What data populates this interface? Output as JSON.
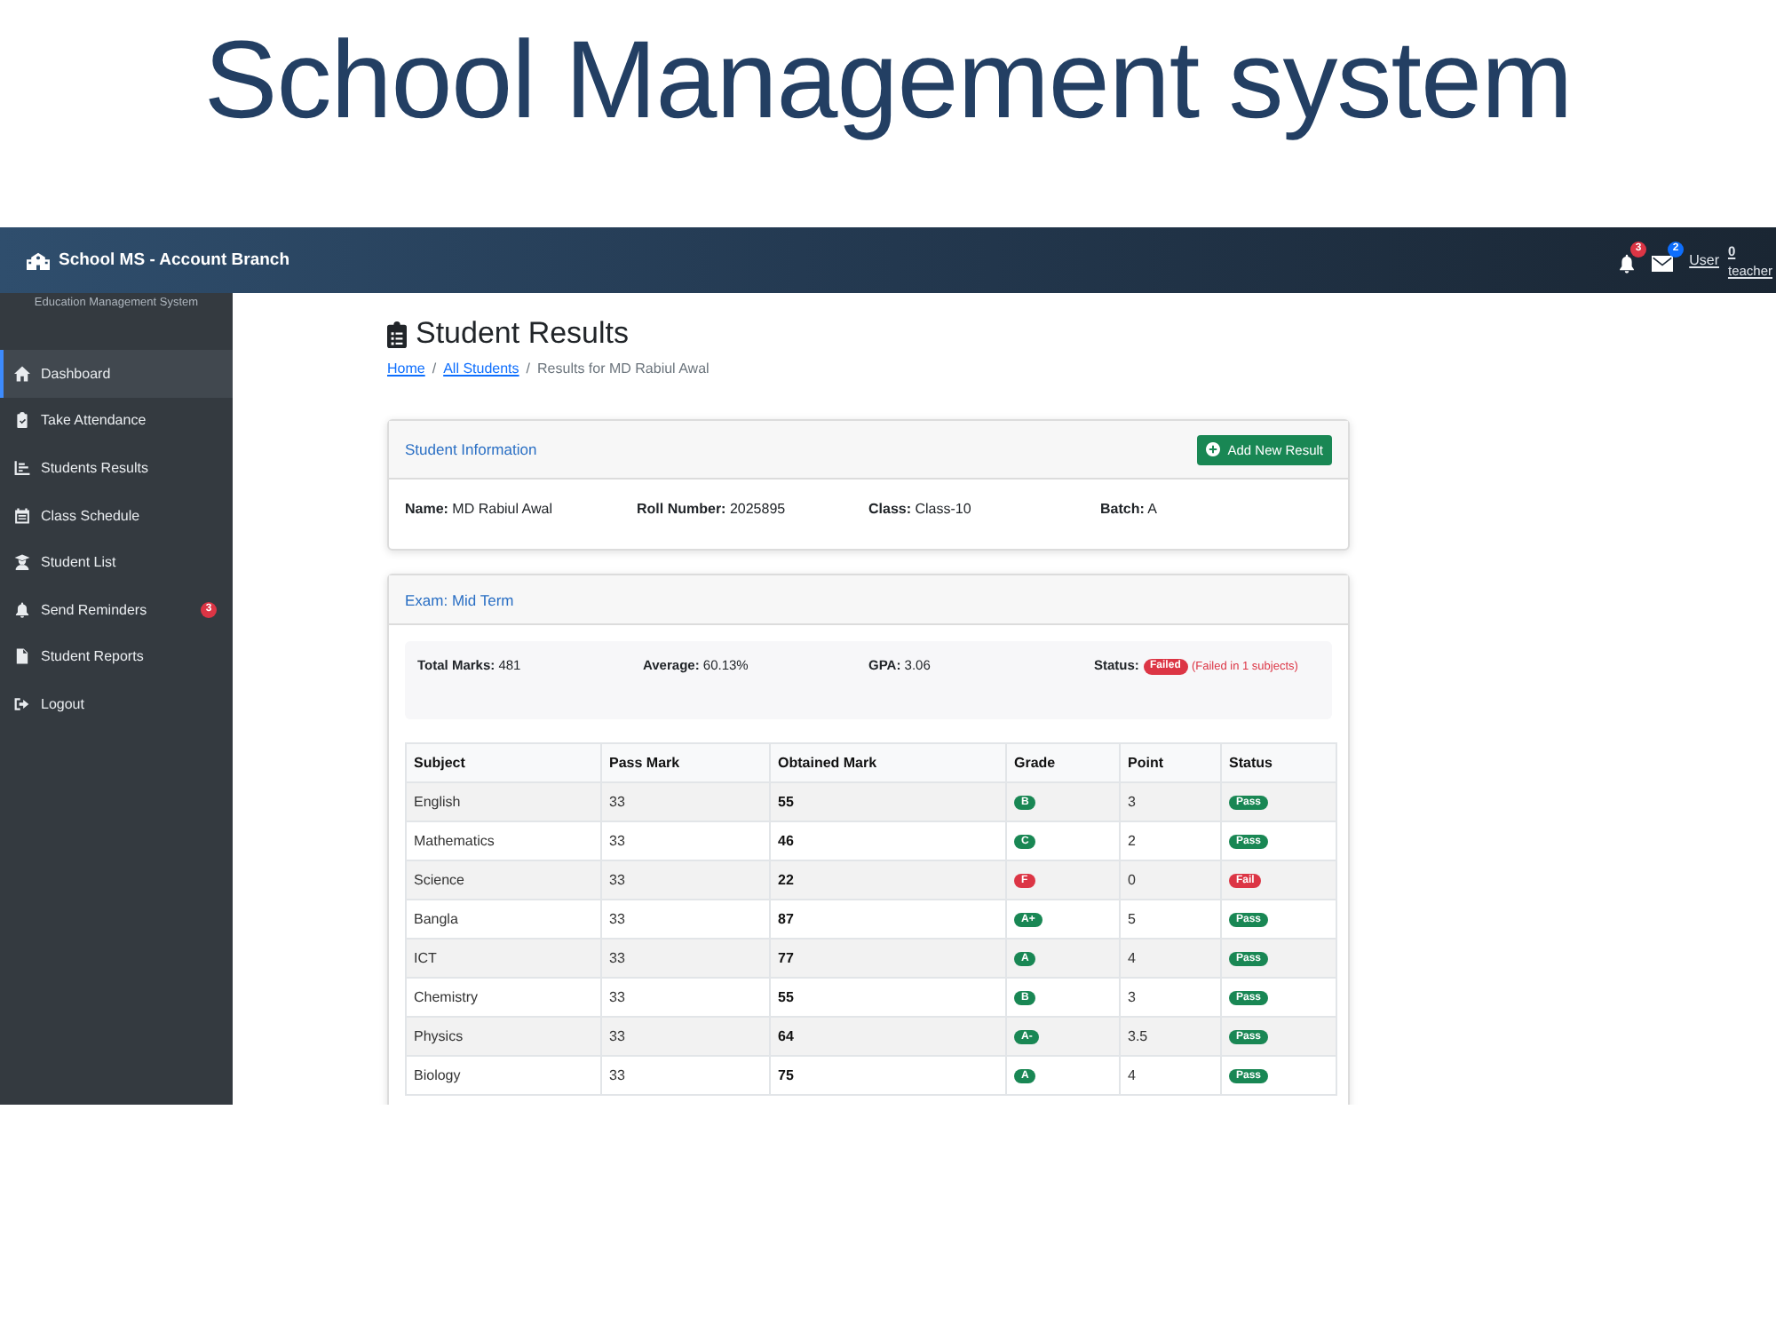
{
  "page_heading": "School Management system",
  "navbar": {
    "brand": "School MS - Account Branch",
    "notification_count": "3",
    "message_count": "2",
    "user_link": "User",
    "role_link": "**0** teacher"
  },
  "sidebar": {
    "subtitle": "Education Management System",
    "items": [
      {
        "label": "Dashboard",
        "selected": true
      },
      {
        "label": "Take Attendance",
        "selected": false
      },
      {
        "label": "Students Results",
        "selected": false
      },
      {
        "label": "Class Schedule",
        "selected": false
      },
      {
        "label": "Student List",
        "selected": false
      },
      {
        "label": "Send Reminders",
        "selected": false,
        "badge": "3"
      },
      {
        "label": "Student Reports",
        "selected": false
      },
      {
        "label": "Logout",
        "selected": false
      }
    ]
  },
  "page": {
    "title": "Student Results",
    "breadcrumb": [
      {
        "kind": "link",
        "label": "Home"
      },
      {
        "kind": "separator",
        "label": "/"
      },
      {
        "kind": "link",
        "label": "All Students"
      },
      {
        "kind": "separator",
        "label": "/"
      },
      {
        "kind": "current",
        "label": "Results for MD Rabiul Awal"
      }
    ]
  },
  "student_card": {
    "title": "Student Information",
    "button": "Add New Result",
    "fields": [
      "**Name:** MD Rabiul Awal",
      "**Roll Number:** 2025895",
      "**Class:** Class-10",
      "**Batch:** A"
    ]
  },
  "exam_card": {
    "title": "Exam: Mid Term",
    "summary": [
      "**Total Marks:** 481",
      "**Average:** 60.13%",
      "**GPA:** 3.06"
    ],
    "status": {
      "label": "Status:",
      "badge": "Failed",
      "passed": false,
      "note": "(Failed in 1 subjects)"
    },
    "table": {
      "columns": [
        "Subject",
        "Pass Mark",
        "Obtained Mark",
        "Grade",
        "Point",
        "Status"
      ],
      "rows": [
        {
          "subject": "English",
          "pass_mark": "33",
          "obtained": "55",
          "grade": "B",
          "point": "3",
          "status": "Pass",
          "passed": true
        },
        {
          "subject": "Mathematics",
          "pass_mark": "33",
          "obtained": "46",
          "grade": "C",
          "point": "2",
          "status": "Pass",
          "passed": true
        },
        {
          "subject": "Science",
          "pass_mark": "33",
          "obtained": "22",
          "grade": "F",
          "point": "0",
          "status": "Fail",
          "passed": false
        },
        {
          "subject": "Bangla",
          "pass_mark": "33",
          "obtained": "87",
          "grade": "A+",
          "point": "5",
          "status": "Pass",
          "passed": true
        },
        {
          "subject": "ICT",
          "pass_mark": "33",
          "obtained": "77",
          "grade": "A",
          "point": "4",
          "status": "Pass",
          "passed": true
        },
        {
          "subject": "Chemistry",
          "pass_mark": "33",
          "obtained": "55",
          "grade": "B",
          "point": "3",
          "status": "Pass",
          "passed": true
        },
        {
          "subject": "Physics",
          "pass_mark": "33",
          "obtained": "64",
          "grade": "A-",
          "point": "3.5",
          "status": "Pass",
          "passed": true
        },
        {
          "subject": "Biology",
          "pass_mark": "33",
          "obtained": "75",
          "grade": "A",
          "point": "4",
          "status": "Pass",
          "passed": true
        }
      ]
    }
  }
}
